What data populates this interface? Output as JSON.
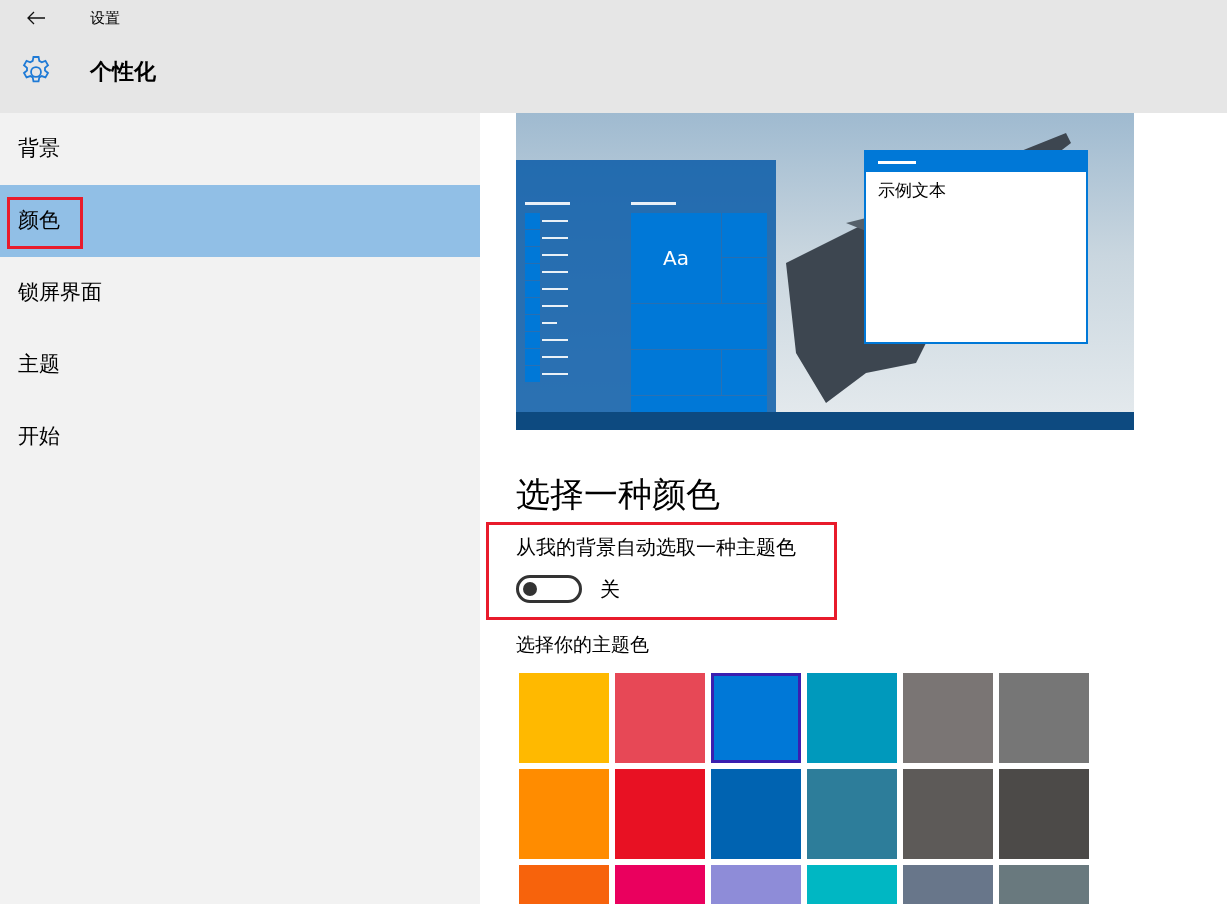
{
  "window": {
    "title": "设置"
  },
  "page": {
    "title": "个性化"
  },
  "sidebar": {
    "items": [
      {
        "label": "背景",
        "selected": false,
        "annotated": false
      },
      {
        "label": "颜色",
        "selected": true,
        "annotated": true
      },
      {
        "label": "锁屏界面",
        "selected": false,
        "annotated": false
      },
      {
        "label": "主题",
        "selected": false,
        "annotated": false
      },
      {
        "label": "开始",
        "selected": false,
        "annotated": false
      }
    ]
  },
  "preview": {
    "sample_window_text": "示例文本",
    "tile_text": "Aa"
  },
  "section_title": "选择一种颜色",
  "auto_color": {
    "label": "从我的背景自动选取一种主题色",
    "on": false,
    "state_text": "关",
    "annotated": true
  },
  "accent": {
    "label": "选择你的主题色",
    "swatches": [
      {
        "color": "#ffb900",
        "selected": false
      },
      {
        "color": "#e74856",
        "selected": false
      },
      {
        "color": "#0078d7",
        "selected": true
      },
      {
        "color": "#0099bc",
        "selected": false
      },
      {
        "color": "#7a7574",
        "selected": false
      },
      {
        "color": "#767676",
        "selected": false
      },
      {
        "color": "#ff8c00",
        "selected": false
      },
      {
        "color": "#e81123",
        "selected": false
      },
      {
        "color": "#0063b1",
        "selected": false
      },
      {
        "color": "#2d7d9a",
        "selected": false
      },
      {
        "color": "#5d5a58",
        "selected": false
      },
      {
        "color": "#4c4a48",
        "selected": false
      },
      {
        "color": "#f7630c",
        "selected": false
      },
      {
        "color": "#ea005e",
        "selected": false
      },
      {
        "color": "#8e8cd8",
        "selected": false
      },
      {
        "color": "#00b7c3",
        "selected": false
      },
      {
        "color": "#68768a",
        "selected": false
      },
      {
        "color": "#69797e",
        "selected": false
      }
    ]
  }
}
